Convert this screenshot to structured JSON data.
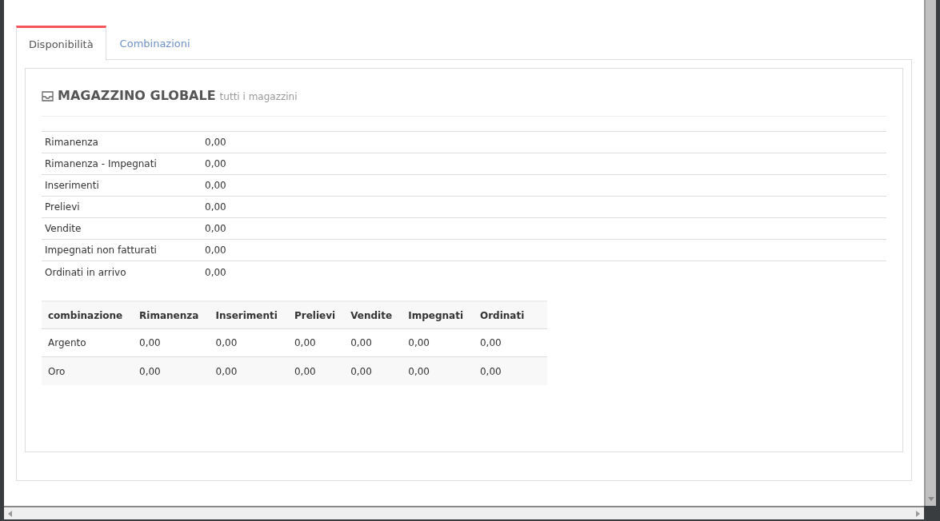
{
  "tabs": [
    {
      "label": "Disponibilità",
      "selected": true
    },
    {
      "label": "Combinazioni",
      "selected": false
    }
  ],
  "warehouse": {
    "title": "MAGAZZINO GLOBALE",
    "subtitle": "tutti i magazzini"
  },
  "stats": [
    {
      "label": "Rimanenza",
      "value": "0,00"
    },
    {
      "label": "Rimanenza - Impegnati",
      "value": "0,00"
    },
    {
      "label": "Inserimenti",
      "value": "0,00"
    },
    {
      "label": "Prelievi",
      "value": "0,00"
    },
    {
      "label": "Vendite",
      "value": "0,00"
    },
    {
      "label": "Impegnati non fatturati",
      "value": "0,00"
    },
    {
      "label": "Ordinati in arrivo",
      "value": "0,00"
    }
  ],
  "combinations": {
    "columns": [
      "combinazione",
      "Rimanenza",
      "Inserimenti",
      "Prelievi",
      "Vendite",
      "Impegnati",
      "Ordinati"
    ],
    "rows": [
      [
        "Argento",
        "0,00",
        "0,00",
        "0,00",
        "0,00",
        "0,00",
        "0,00"
      ],
      [
        "Oro",
        "0,00",
        "0,00",
        "0,00",
        "0,00",
        "0,00",
        "0,00"
      ]
    ]
  }
}
